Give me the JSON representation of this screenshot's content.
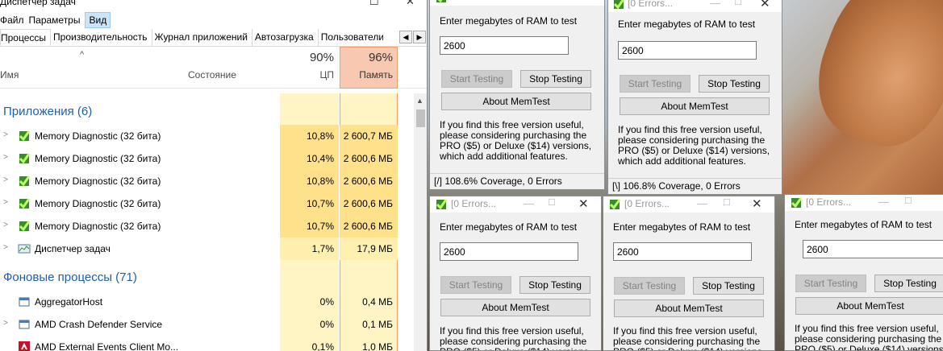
{
  "task_manager": {
    "title": "Диспетчер задач",
    "menu": [
      "Файл",
      "Параметры",
      "Вид"
    ],
    "tabs": [
      "Процессы",
      "Производительность",
      "Журнал приложений",
      "Автозагрузка",
      "Пользователи"
    ],
    "columns": {
      "name": "Имя",
      "state": "Состояние",
      "cpu_pct": "90%",
      "cpu": "ЦП",
      "mem_pct": "96%",
      "mem": "Память"
    },
    "groups": {
      "apps": "Приложения (6)",
      "background": "Фоновые процессы (71)"
    },
    "rows": [
      {
        "name": "Memory Diagnostic (32 бита)",
        "cpu": "10,8%",
        "mem": "2 600,7 МБ",
        "icon": "memtest-icon"
      },
      {
        "name": "Memory Diagnostic (32 бита)",
        "cpu": "10,4%",
        "mem": "2 600,6 МБ",
        "icon": "memtest-icon"
      },
      {
        "name": "Memory Diagnostic (32 бита)",
        "cpu": "10,8%",
        "mem": "2 600,6 МБ",
        "icon": "memtest-icon"
      },
      {
        "name": "Memory Diagnostic (32 бита)",
        "cpu": "10,7%",
        "mem": "2 600,6 МБ",
        "icon": "memtest-icon"
      },
      {
        "name": "Memory Diagnostic (32 бита)",
        "cpu": "10,7%",
        "mem": "2 600,6 МБ",
        "icon": "memtest-icon"
      },
      {
        "name": "Диспетчер задач",
        "cpu": "1,7%",
        "mem": "17,9 МБ",
        "icon": "task-manager-icon"
      },
      {
        "name": "AggregatorHost",
        "cpu": "0%",
        "mem": "0,4 МБ",
        "icon": "window-icon"
      },
      {
        "name": "AMD Crash Defender Service",
        "cpu": "0%",
        "mem": "0,1 МБ",
        "icon": "window-icon"
      },
      {
        "name": "AMD External Events Client Mo...",
        "cpu": "0,1%",
        "mem": "1,0 МБ",
        "icon": "amd-icon"
      }
    ]
  },
  "memtest": {
    "title": "[0 Errors...",
    "prompt": "Enter megabytes of RAM to test",
    "value": "2600",
    "start": "Start Testing",
    "stop": "Stop Testing",
    "about": "About MemTest",
    "note": "If you find this free version useful, please considering purchasing the PRO ($5) or Deluxe ($14) versions, which add additional features.",
    "status1": "[/]  108.6% Coverage, 0 Errors",
    "status2": "[\\]  106.8% Coverage, 0 Errors"
  },
  "colors": {
    "group_blue": "#1e5eb0",
    "mem_header": "#f8c8b0",
    "heat": "#ffe18c"
  }
}
